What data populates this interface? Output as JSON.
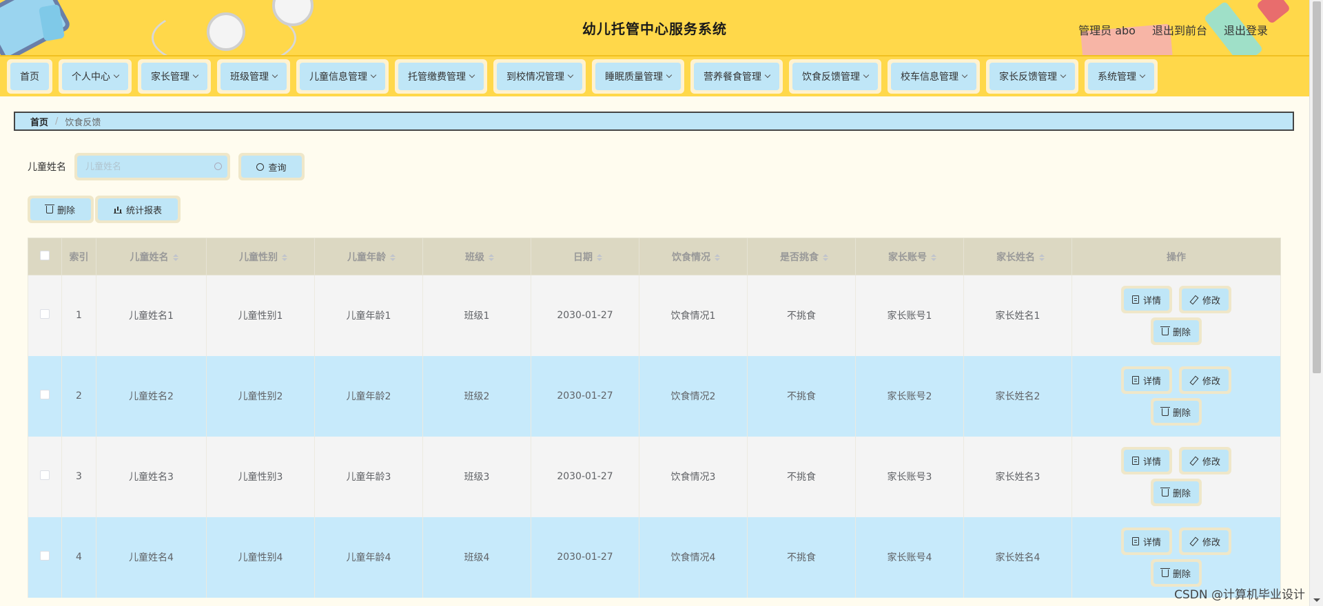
{
  "header": {
    "title": "幼儿托管中心服务系统",
    "user_label": "管理员 abo",
    "to_front_label": "退出到前台",
    "logout_label": "退出登录"
  },
  "nav": [
    {
      "label": "首页",
      "dropdown": false
    },
    {
      "label": "个人中心",
      "dropdown": true
    },
    {
      "label": "家长管理",
      "dropdown": true
    },
    {
      "label": "班级管理",
      "dropdown": true
    },
    {
      "label": "儿童信息管理",
      "dropdown": true
    },
    {
      "label": "托管缴费管理",
      "dropdown": true
    },
    {
      "label": "到校情况管理",
      "dropdown": true
    },
    {
      "label": "睡眠质量管理",
      "dropdown": true
    },
    {
      "label": "营养餐食管理",
      "dropdown": true
    },
    {
      "label": "饮食反馈管理",
      "dropdown": true
    },
    {
      "label": "校车信息管理",
      "dropdown": true
    },
    {
      "label": "家长反馈管理",
      "dropdown": true
    },
    {
      "label": "系统管理",
      "dropdown": true
    }
  ],
  "breadcrumb": {
    "home": "首页",
    "separator": "/",
    "current": "饮食反馈"
  },
  "search": {
    "label": "儿童姓名",
    "placeholder": "儿童姓名",
    "value": "",
    "button_label": "查询"
  },
  "actions": {
    "delete_label": "删除",
    "report_label": "统计报表"
  },
  "table": {
    "columns": [
      "索引",
      "儿童姓名",
      "儿童性别",
      "儿童年龄",
      "班级",
      "日期",
      "饮食情况",
      "是否挑食",
      "家长账号",
      "家长姓名",
      "操作"
    ],
    "row_buttons": {
      "detail": "详情",
      "edit": "修改",
      "delete": "删除"
    },
    "rows": [
      {
        "index": "1",
        "name": "儿童姓名1",
        "gender": "儿童性别1",
        "age": "儿童年龄1",
        "class": "班级1",
        "date": "2030-01-27",
        "diet": "饮食情况1",
        "picky": "不挑食",
        "parent_account": "家长账号1",
        "parent_name": "家长姓名1"
      },
      {
        "index": "2",
        "name": "儿童姓名2",
        "gender": "儿童性别2",
        "age": "儿童年龄2",
        "class": "班级2",
        "date": "2030-01-27",
        "diet": "饮食情况2",
        "picky": "不挑食",
        "parent_account": "家长账号2",
        "parent_name": "家长姓名2"
      },
      {
        "index": "3",
        "name": "儿童姓名3",
        "gender": "儿童性别3",
        "age": "儿童年龄3",
        "class": "班级3",
        "date": "2030-01-27",
        "diet": "饮食情况3",
        "picky": "不挑食",
        "parent_account": "家长账号3",
        "parent_name": "家长姓名3"
      },
      {
        "index": "4",
        "name": "儿童姓名4",
        "gender": "儿童性别4",
        "age": "儿童年龄4",
        "class": "班级4",
        "date": "2030-01-27",
        "diet": "饮食情况4",
        "picky": "不挑食",
        "parent_account": "家长账号4",
        "parent_name": "家长姓名4"
      }
    ]
  },
  "watermark": "CSDN @计算机毕业设计",
  "colors": {
    "header_bg": "#ffd84a",
    "button_bg": "#bfe6f7",
    "button_border": "#efe7c9",
    "row_even": "#c7eafb",
    "row_odd": "#f4f4f4",
    "table_header": "#dcd8c2",
    "page_bg": "#fffcef"
  }
}
